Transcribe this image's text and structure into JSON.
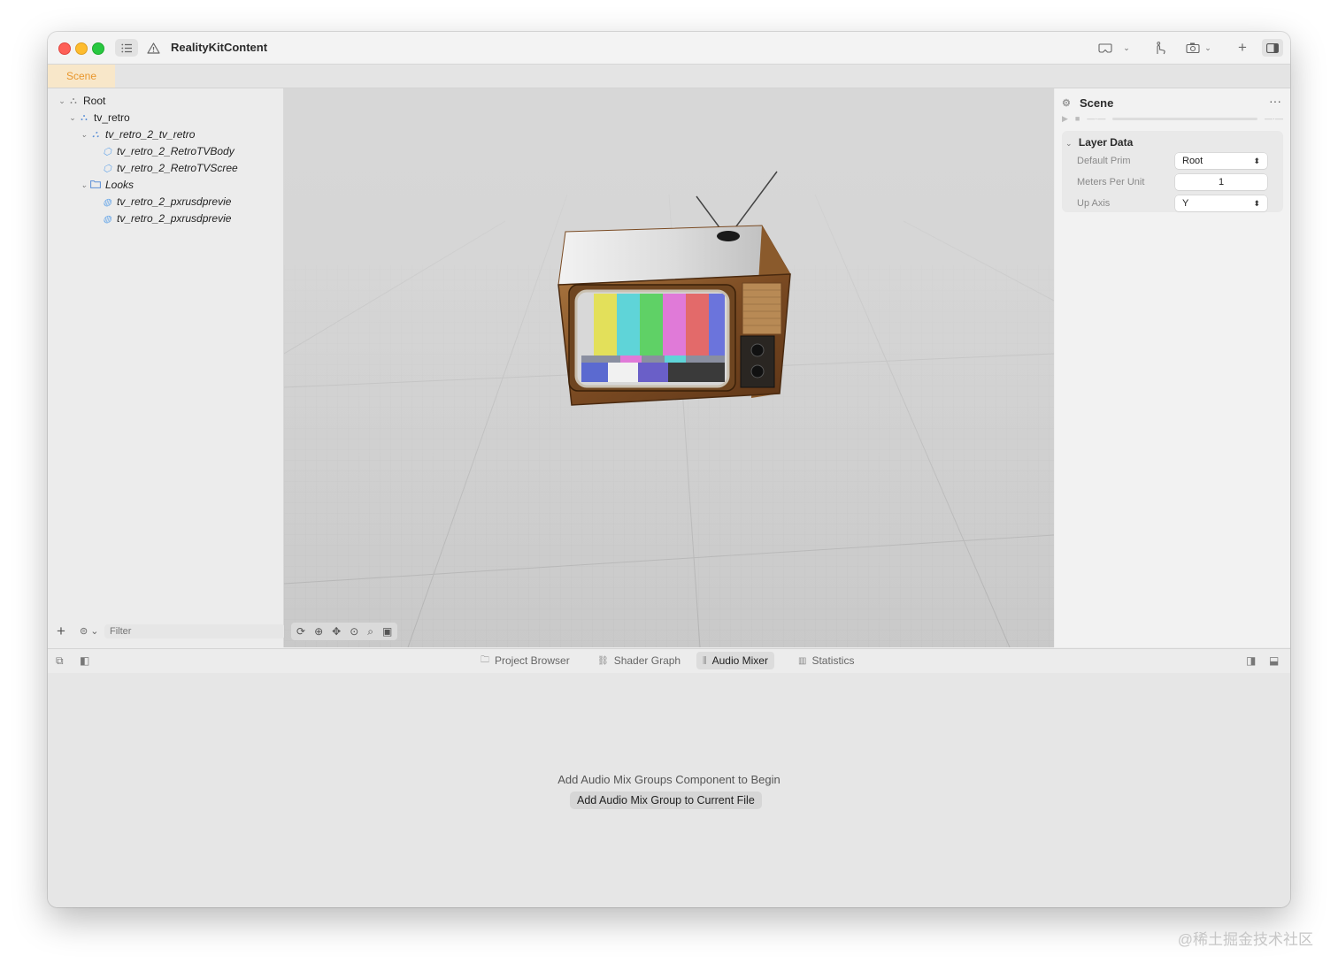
{
  "window": {
    "title": "RealityKitContent"
  },
  "toolbar": {
    "sidebar_icon": "list-icon",
    "warning_icon": "warning-icon",
    "icons": [
      "vr-headset-icon",
      "chevron-down-icon",
      "gesture-icon",
      "camera-icon",
      "chevron-down-icon",
      "plus-icon",
      "inspector-toggle-icon"
    ]
  },
  "editor_tab": {
    "label": "Scene",
    "color": "#e8962c"
  },
  "hierarchy": {
    "items": [
      {
        "label": "Root",
        "depth": 0,
        "expanded": true,
        "icon": "entity-icon",
        "italic": false
      },
      {
        "label": "tv_retro",
        "depth": 1,
        "expanded": true,
        "icon": "entity-icon",
        "italic": false
      },
      {
        "label": "tv_retro_2_tv_retro",
        "depth": 2,
        "expanded": true,
        "icon": "entity-icon",
        "italic": true
      },
      {
        "label": "tv_retro_2_RetroTVBody",
        "depth": 3,
        "icon": "cube-icon",
        "italic": true
      },
      {
        "label": "tv_retro_2_RetroTVScree",
        "depth": 3,
        "icon": "cube-icon",
        "italic": true
      },
      {
        "label": "Looks",
        "depth": 2,
        "expanded": true,
        "icon": "folder-icon",
        "italic": true
      },
      {
        "label": "tv_retro_2_pxrusdprevie",
        "depth": 3,
        "icon": "material-icon",
        "italic": true
      },
      {
        "label": "tv_retro_2_pxrusdprevie",
        "depth": 3,
        "icon": "material-icon",
        "italic": true
      }
    ],
    "filter_placeholder": "Filter"
  },
  "viewport_tools": [
    "orbit-icon",
    "pan-icon",
    "move-icon",
    "center-icon",
    "zoom-icon",
    "camera-view-icon"
  ],
  "inspector": {
    "title": "Scene",
    "section": {
      "title": "Layer Data",
      "properties": [
        {
          "label": "Default Prim",
          "value": "Root",
          "control": "popup"
        },
        {
          "label": "Meters Per Unit",
          "value": "1",
          "control": "field"
        },
        {
          "label": "Up Axis",
          "value": "Y",
          "control": "popup"
        }
      ]
    }
  },
  "bottom_tabs": [
    {
      "label": "Project Browser",
      "icon": "folder-icon",
      "active": false
    },
    {
      "label": "Shader Graph",
      "icon": "node-graph-icon",
      "active": false
    },
    {
      "label": "Audio Mixer",
      "icon": "mixer-icon",
      "active": true
    },
    {
      "label": "Statistics",
      "icon": "chart-icon",
      "active": false
    }
  ],
  "audio_mixer": {
    "message": "Add Audio Mix Groups Component to Begin",
    "button": "Add Audio Mix Group to Current File"
  },
  "watermark": "@稀土掘金技术社区"
}
